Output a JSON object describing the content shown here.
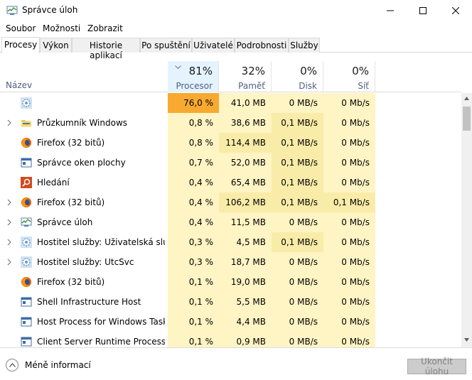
{
  "window": {
    "title": "Správce úloh"
  },
  "menu": [
    "Soubor",
    "Možnosti",
    "Zobrazit"
  ],
  "tabs": [
    "Procesy",
    "Výkon",
    "Historie aplikací",
    "Po spuštění",
    "Uživatelé",
    "Podrobnosti",
    "Služby"
  ],
  "columns": {
    "name": "Název",
    "cpu": {
      "pct": "81%",
      "label": "Procesor"
    },
    "mem": {
      "pct": "32%",
      "label": "Paměť"
    },
    "disk": {
      "pct": "0%",
      "label": "Disk"
    },
    "net": {
      "pct": "0%",
      "label": "Síť"
    }
  },
  "rows": [
    {
      "name": "",
      "icon": "gear-icon",
      "expandable": false,
      "cpu": "76,0 %",
      "mem": "41,0 MB",
      "disk": "0 MB/s",
      "net": "0 Mb/s"
    },
    {
      "name": "Průzkumník Windows",
      "icon": "folder-icon",
      "expandable": true,
      "cpu": "0,8 %",
      "mem": "38,6 MB",
      "disk": "0,1 MB/s",
      "net": "0 Mb/s"
    },
    {
      "name": "Firefox (32 bitů)",
      "icon": "firefox-icon",
      "expandable": false,
      "cpu": "0,8 %",
      "mem": "114,4 MB",
      "disk": "0,1 MB/s",
      "net": "0 Mb/s"
    },
    {
      "name": "Správce oken plochy",
      "icon": "window-icon",
      "expandable": false,
      "cpu": "0,7 %",
      "mem": "52,0 MB",
      "disk": "0,1 MB/s",
      "net": "0 Mb/s"
    },
    {
      "name": "Hledání",
      "icon": "search-icon",
      "expandable": false,
      "cpu": "0,4 %",
      "mem": "65,4 MB",
      "disk": "0,1 MB/s",
      "net": "0 Mb/s"
    },
    {
      "name": "Firefox (32 bitů)",
      "icon": "firefox-icon",
      "expandable": true,
      "cpu": "0,4 %",
      "mem": "106,2 MB",
      "disk": "0,1 MB/s",
      "net": "0,1 Mb/s"
    },
    {
      "name": "Správce úloh",
      "icon": "taskmgr-icon",
      "expandable": true,
      "cpu": "0,4 %",
      "mem": "11,5 MB",
      "disk": "0 MB/s",
      "net": "0 Mb/s"
    },
    {
      "name": "Hostitel služby: Uživatelská služ...",
      "icon": "gear-icon",
      "expandable": true,
      "cpu": "0,3 %",
      "mem": "4,5 MB",
      "disk": "0,1 MB/s",
      "net": "0 Mb/s"
    },
    {
      "name": "Hostitel služby: UtcSvc",
      "icon": "gear-icon",
      "expandable": true,
      "cpu": "0,3 %",
      "mem": "18,7 MB",
      "disk": "0 MB/s",
      "net": "0 Mb/s"
    },
    {
      "name": "Firefox (32 bitů)",
      "icon": "firefox-icon",
      "expandable": false,
      "cpu": "0,1 %",
      "mem": "19,0 MB",
      "disk": "0 MB/s",
      "net": "0 Mb/s"
    },
    {
      "name": "Shell Infrastructure Host",
      "icon": "window-icon",
      "expandable": false,
      "cpu": "0,1 %",
      "mem": "5,5 MB",
      "disk": "0 MB/s",
      "net": "0 Mb/s"
    },
    {
      "name": "Host Process for Windows Tasks",
      "icon": "window-icon",
      "expandable": false,
      "cpu": "0,1 %",
      "mem": "4,4 MB",
      "disk": "0 MB/s",
      "net": "0 Mb/s"
    },
    {
      "name": "Client Server Runtime Process",
      "icon": "window-icon",
      "expandable": false,
      "cpu": "0,1 %",
      "mem": "0,9 MB",
      "disk": "0 MB/s",
      "net": "0 Mb/s"
    }
  ],
  "footer": {
    "less_info": "Méně informací",
    "end_task": "Ukončit úlohu"
  },
  "colors": {
    "cpu_hot": "#f7a930",
    "heat_light": "#fff4c4",
    "heat_mid": "#f9eca8",
    "header_label": "#4d6082"
  }
}
